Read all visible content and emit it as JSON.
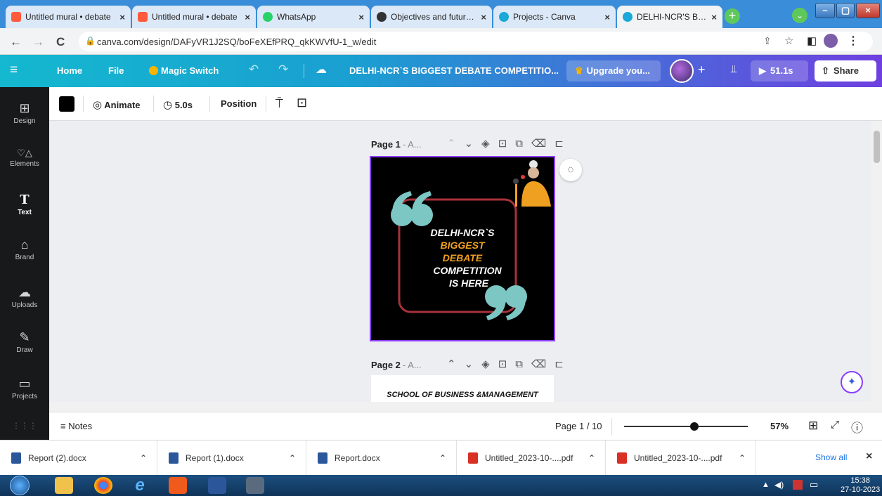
{
  "browser": {
    "tabs": [
      {
        "title": "Untitled mural • debate",
        "favicon_color": "#ff5a3c"
      },
      {
        "title": "Untitled mural • debate",
        "favicon_color": "#ff5a3c"
      },
      {
        "title": "WhatsApp",
        "favicon_color": "#25d366"
      },
      {
        "title": "Objectives and future p",
        "favicon_color": "#333333"
      },
      {
        "title": "Projects - Canva",
        "favicon_color": "#1aa9d8"
      },
      {
        "title": "DELHI-NCR'S BIGGEST",
        "favicon_color": "#1aa9d8"
      }
    ],
    "tab_close": "×",
    "new_tab": "+",
    "url": "canva.com/design/DAFyVR1J2SQ/boFeXEfPRQ_qkKWVfU-1_w/edit",
    "window_controls": {
      "minimize": "–",
      "maximize": "▢",
      "close": "×"
    }
  },
  "canva_header": {
    "menu_icon": "≡",
    "home": "Home",
    "file": "File",
    "magic_switch": "Magic Switch",
    "design_title": "DELHI-NCR`S BIGGEST DEBATE COMPETITIO...",
    "upgrade": "Upgrade you...",
    "present_time": "51.1s",
    "share": "Share",
    "plus": "+"
  },
  "sidebar": {
    "items": [
      {
        "label": "Design",
        "icon": "⊞"
      },
      {
        "label": "Elements",
        "icon": "♡△"
      },
      {
        "label": "Text",
        "icon": "T"
      },
      {
        "label": "Brand",
        "icon": "⌂"
      },
      {
        "label": "Uploads",
        "icon": "☁"
      },
      {
        "label": "Draw",
        "icon": "✎"
      },
      {
        "label": "Projects",
        "icon": "▭"
      }
    ]
  },
  "context_toolbar": {
    "color": "#000000",
    "animate": "Animate",
    "duration": "5.0s",
    "position": "Position"
  },
  "pages": [
    {
      "label": "Page 1",
      "suffix": "- A..."
    },
    {
      "label": "Page 2",
      "suffix": "- A..."
    }
  ],
  "slide1": {
    "line1": "DELHI-NCR`S",
    "line2": "BIGGEST",
    "line3": "DEBATE",
    "line4": "COMPETITION",
    "line5": "IS HERE"
  },
  "slide2": {
    "heading": "SCHOOL OF BUSINESS &MANAGEMENT"
  },
  "bottom_bar": {
    "notes": "Notes",
    "page_indicator": "Page 1 / 10",
    "zoom": "57%",
    "zoom_fraction": 0.57
  },
  "downloads": {
    "files": [
      {
        "name": "Report (2).docx",
        "type": "word"
      },
      {
        "name": "Report (1).docx",
        "type": "word"
      },
      {
        "name": "Report.docx",
        "type": "word"
      },
      {
        "name": "Untitled_2023-10-....pdf",
        "type": "pdf"
      },
      {
        "name": "Untitled_2023-10-....pdf",
        "type": "pdf"
      }
    ],
    "show_all": "Show all",
    "close": "×"
  },
  "taskbar": {
    "time": "15:38",
    "date": "27-10-2023"
  },
  "colors": {
    "canva_gradient_start": "#14b8cf",
    "canva_gradient_end": "#6f3fe0",
    "slide_accent_orange": "#f0a020",
    "slide_quote_teal": "#7cc6c4",
    "slide_frame_red": "#a8323a",
    "selection_purple": "#8b3dff"
  }
}
